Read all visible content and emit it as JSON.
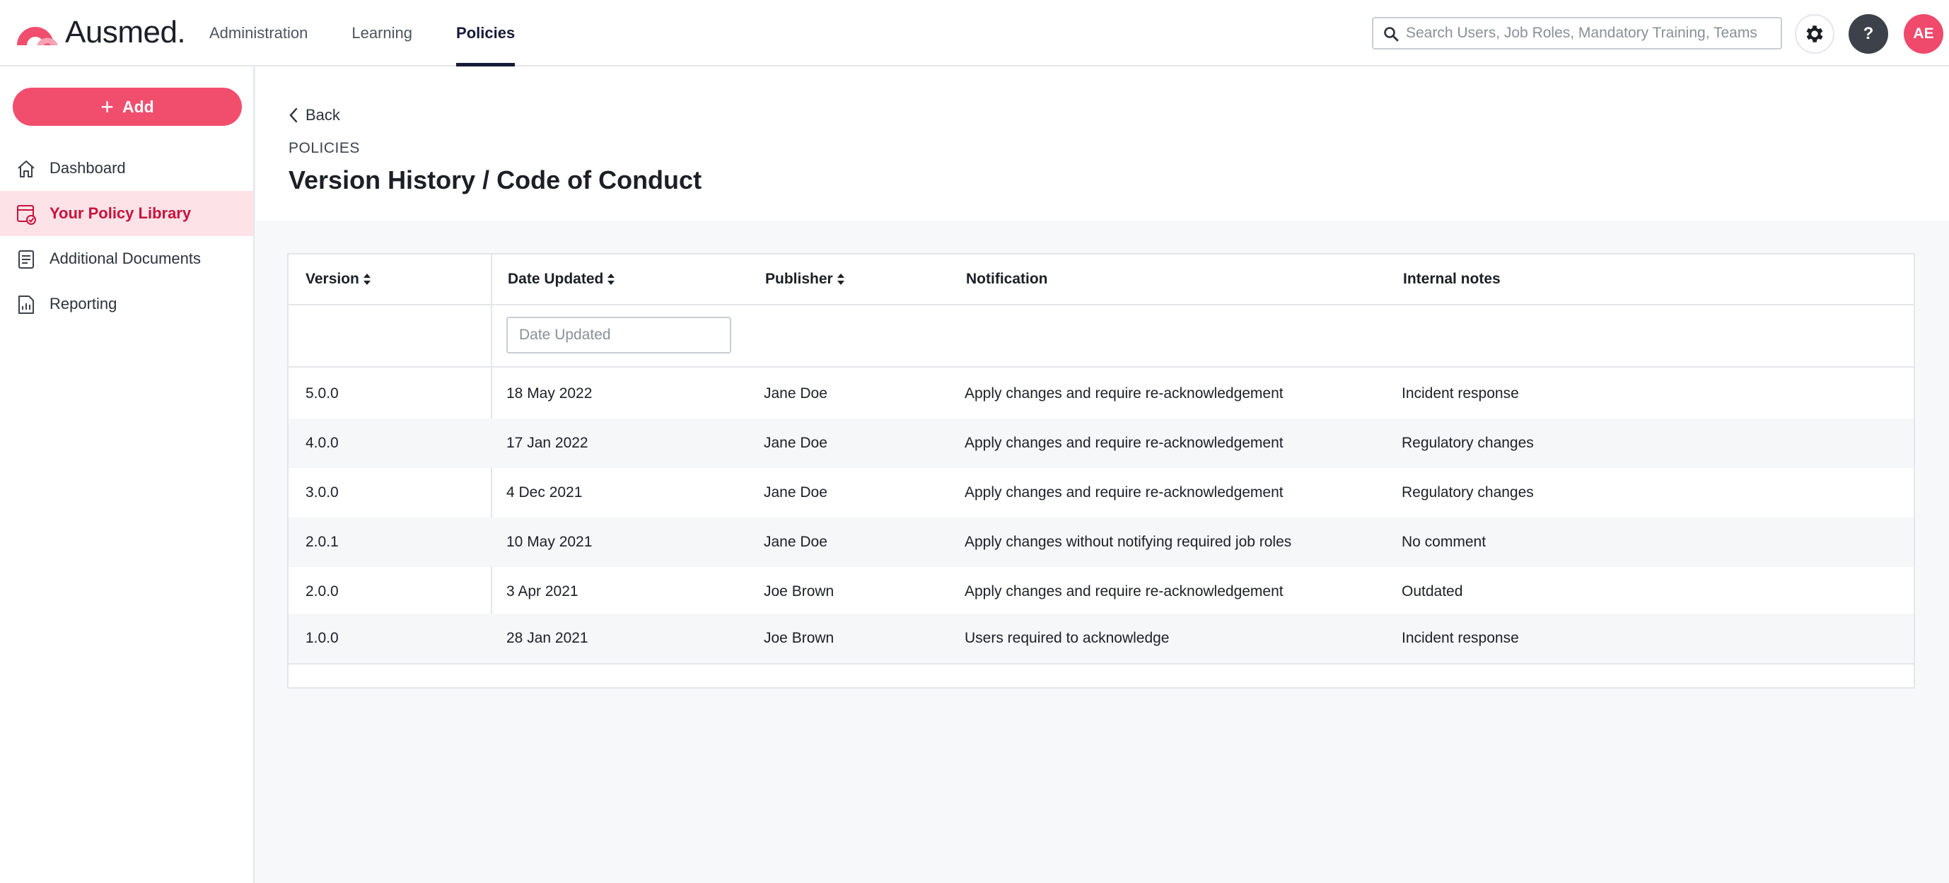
{
  "brand": {
    "name": "Ausmed",
    "accent": "#f14e6e",
    "nav_active": "#151a3a"
  },
  "topnav": {
    "items": [
      {
        "label": "Administration",
        "active": false
      },
      {
        "label": "Learning",
        "active": false
      },
      {
        "label": "Policies",
        "active": true
      }
    ]
  },
  "search": {
    "placeholder": "Search Users, Job Roles, Mandatory Training, Teams",
    "value": ""
  },
  "header_actions": {
    "help_label": "?",
    "avatar_initials": "AE"
  },
  "sidebar": {
    "add_label": "Add",
    "items": [
      {
        "label": "Dashboard",
        "icon": "home-icon",
        "active": false
      },
      {
        "label": "Your Policy Library",
        "icon": "policy-library-icon",
        "active": true
      },
      {
        "label": "Additional Documents",
        "icon": "document-icon",
        "active": false
      },
      {
        "label": "Reporting",
        "icon": "report-icon",
        "active": false
      }
    ]
  },
  "page": {
    "back_label": "Back",
    "eyebrow": "POLICIES",
    "title": "Version History / Code of Conduct"
  },
  "table": {
    "columns": [
      "Version",
      "Date Updated",
      "Publisher",
      "Notification",
      "Internal notes"
    ],
    "date_filter_placeholder": "Date Updated",
    "rows": [
      {
        "version": "5.0.0",
        "date": "18 May 2022",
        "publisher": "Jane Doe",
        "notification": "Apply changes and require re-acknowledgement",
        "notes": "Incident response"
      },
      {
        "version": "4.0.0",
        "date": "17 Jan 2022",
        "publisher": "Jane Doe",
        "notification": "Apply changes and require re-acknowledgement",
        "notes": "Regulatory changes"
      },
      {
        "version": "3.0.0",
        "date": "4 Dec 2021",
        "publisher": "Jane Doe",
        "notification": "Apply changes and require re-acknowledgement",
        "notes": "Regulatory changes"
      },
      {
        "version": "2.0.1",
        "date": "10 May 2021",
        "publisher": "Jane Doe",
        "notification": "Apply changes without notifying required job roles",
        "notes": "No comment"
      },
      {
        "version": "2.0.0",
        "date": "3 Apr 2021",
        "publisher": "Joe Brown",
        "notification": "Apply changes and require re-acknowledgement",
        "notes": "Outdated"
      },
      {
        "version": "1.0.0",
        "date": "28 Jan 2021",
        "publisher": "Joe Brown",
        "notification": "Users required to acknowledge",
        "notes": "Incident response"
      }
    ]
  }
}
